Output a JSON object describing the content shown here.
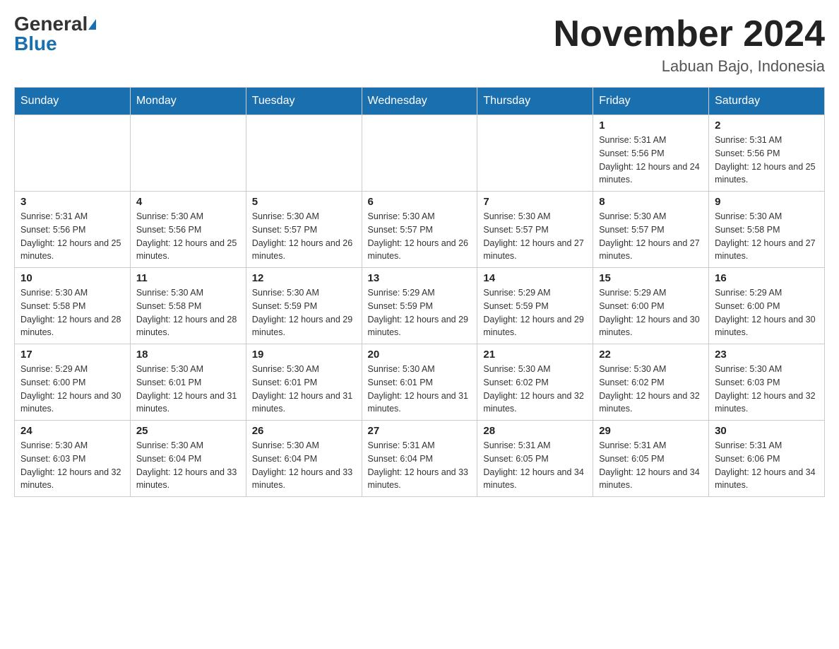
{
  "header": {
    "logo_general": "General",
    "logo_blue": "Blue",
    "month_title": "November 2024",
    "location": "Labuan Bajo, Indonesia"
  },
  "calendar": {
    "days_of_week": [
      "Sunday",
      "Monday",
      "Tuesday",
      "Wednesday",
      "Thursday",
      "Friday",
      "Saturday"
    ],
    "weeks": [
      [
        {
          "num": "",
          "sunrise": "",
          "sunset": "",
          "daylight": ""
        },
        {
          "num": "",
          "sunrise": "",
          "sunset": "",
          "daylight": ""
        },
        {
          "num": "",
          "sunrise": "",
          "sunset": "",
          "daylight": ""
        },
        {
          "num": "",
          "sunrise": "",
          "sunset": "",
          "daylight": ""
        },
        {
          "num": "",
          "sunrise": "",
          "sunset": "",
          "daylight": ""
        },
        {
          "num": "1",
          "sunrise": "Sunrise: 5:31 AM",
          "sunset": "Sunset: 5:56 PM",
          "daylight": "Daylight: 12 hours and 24 minutes."
        },
        {
          "num": "2",
          "sunrise": "Sunrise: 5:31 AM",
          "sunset": "Sunset: 5:56 PM",
          "daylight": "Daylight: 12 hours and 25 minutes."
        }
      ],
      [
        {
          "num": "3",
          "sunrise": "Sunrise: 5:31 AM",
          "sunset": "Sunset: 5:56 PM",
          "daylight": "Daylight: 12 hours and 25 minutes."
        },
        {
          "num": "4",
          "sunrise": "Sunrise: 5:30 AM",
          "sunset": "Sunset: 5:56 PM",
          "daylight": "Daylight: 12 hours and 25 minutes."
        },
        {
          "num": "5",
          "sunrise": "Sunrise: 5:30 AM",
          "sunset": "Sunset: 5:57 PM",
          "daylight": "Daylight: 12 hours and 26 minutes."
        },
        {
          "num": "6",
          "sunrise": "Sunrise: 5:30 AM",
          "sunset": "Sunset: 5:57 PM",
          "daylight": "Daylight: 12 hours and 26 minutes."
        },
        {
          "num": "7",
          "sunrise": "Sunrise: 5:30 AM",
          "sunset": "Sunset: 5:57 PM",
          "daylight": "Daylight: 12 hours and 27 minutes."
        },
        {
          "num": "8",
          "sunrise": "Sunrise: 5:30 AM",
          "sunset": "Sunset: 5:57 PM",
          "daylight": "Daylight: 12 hours and 27 minutes."
        },
        {
          "num": "9",
          "sunrise": "Sunrise: 5:30 AM",
          "sunset": "Sunset: 5:58 PM",
          "daylight": "Daylight: 12 hours and 27 minutes."
        }
      ],
      [
        {
          "num": "10",
          "sunrise": "Sunrise: 5:30 AM",
          "sunset": "Sunset: 5:58 PM",
          "daylight": "Daylight: 12 hours and 28 minutes."
        },
        {
          "num": "11",
          "sunrise": "Sunrise: 5:30 AM",
          "sunset": "Sunset: 5:58 PM",
          "daylight": "Daylight: 12 hours and 28 minutes."
        },
        {
          "num": "12",
          "sunrise": "Sunrise: 5:30 AM",
          "sunset": "Sunset: 5:59 PM",
          "daylight": "Daylight: 12 hours and 29 minutes."
        },
        {
          "num": "13",
          "sunrise": "Sunrise: 5:29 AM",
          "sunset": "Sunset: 5:59 PM",
          "daylight": "Daylight: 12 hours and 29 minutes."
        },
        {
          "num": "14",
          "sunrise": "Sunrise: 5:29 AM",
          "sunset": "Sunset: 5:59 PM",
          "daylight": "Daylight: 12 hours and 29 minutes."
        },
        {
          "num": "15",
          "sunrise": "Sunrise: 5:29 AM",
          "sunset": "Sunset: 6:00 PM",
          "daylight": "Daylight: 12 hours and 30 minutes."
        },
        {
          "num": "16",
          "sunrise": "Sunrise: 5:29 AM",
          "sunset": "Sunset: 6:00 PM",
          "daylight": "Daylight: 12 hours and 30 minutes."
        }
      ],
      [
        {
          "num": "17",
          "sunrise": "Sunrise: 5:29 AM",
          "sunset": "Sunset: 6:00 PM",
          "daylight": "Daylight: 12 hours and 30 minutes."
        },
        {
          "num": "18",
          "sunrise": "Sunrise: 5:30 AM",
          "sunset": "Sunset: 6:01 PM",
          "daylight": "Daylight: 12 hours and 31 minutes."
        },
        {
          "num": "19",
          "sunrise": "Sunrise: 5:30 AM",
          "sunset": "Sunset: 6:01 PM",
          "daylight": "Daylight: 12 hours and 31 minutes."
        },
        {
          "num": "20",
          "sunrise": "Sunrise: 5:30 AM",
          "sunset": "Sunset: 6:01 PM",
          "daylight": "Daylight: 12 hours and 31 minutes."
        },
        {
          "num": "21",
          "sunrise": "Sunrise: 5:30 AM",
          "sunset": "Sunset: 6:02 PM",
          "daylight": "Daylight: 12 hours and 32 minutes."
        },
        {
          "num": "22",
          "sunrise": "Sunrise: 5:30 AM",
          "sunset": "Sunset: 6:02 PM",
          "daylight": "Daylight: 12 hours and 32 minutes."
        },
        {
          "num": "23",
          "sunrise": "Sunrise: 5:30 AM",
          "sunset": "Sunset: 6:03 PM",
          "daylight": "Daylight: 12 hours and 32 minutes."
        }
      ],
      [
        {
          "num": "24",
          "sunrise": "Sunrise: 5:30 AM",
          "sunset": "Sunset: 6:03 PM",
          "daylight": "Daylight: 12 hours and 32 minutes."
        },
        {
          "num": "25",
          "sunrise": "Sunrise: 5:30 AM",
          "sunset": "Sunset: 6:04 PM",
          "daylight": "Daylight: 12 hours and 33 minutes."
        },
        {
          "num": "26",
          "sunrise": "Sunrise: 5:30 AM",
          "sunset": "Sunset: 6:04 PM",
          "daylight": "Daylight: 12 hours and 33 minutes."
        },
        {
          "num": "27",
          "sunrise": "Sunrise: 5:31 AM",
          "sunset": "Sunset: 6:04 PM",
          "daylight": "Daylight: 12 hours and 33 minutes."
        },
        {
          "num": "28",
          "sunrise": "Sunrise: 5:31 AM",
          "sunset": "Sunset: 6:05 PM",
          "daylight": "Daylight: 12 hours and 34 minutes."
        },
        {
          "num": "29",
          "sunrise": "Sunrise: 5:31 AM",
          "sunset": "Sunset: 6:05 PM",
          "daylight": "Daylight: 12 hours and 34 minutes."
        },
        {
          "num": "30",
          "sunrise": "Sunrise: 5:31 AM",
          "sunset": "Sunset: 6:06 PM",
          "daylight": "Daylight: 12 hours and 34 minutes."
        }
      ]
    ]
  }
}
